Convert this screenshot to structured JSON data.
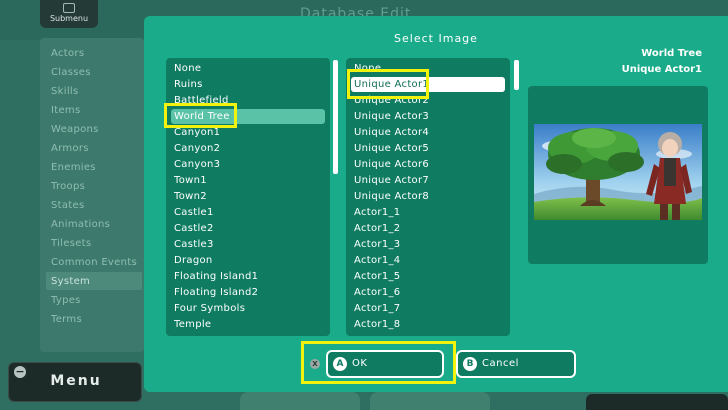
{
  "background": {
    "title": "Database Edit",
    "submenu_label": "Submenu",
    "sidebar_items": [
      "Actors",
      "Classes",
      "Skills",
      "Items",
      "Weapons",
      "Armors",
      "Enemies",
      "Troops",
      "States",
      "Animations",
      "Tilesets",
      "Common Events",
      "System",
      "Types",
      "Terms"
    ],
    "sidebar_selected": "System",
    "menu_label": "Menu"
  },
  "dialog": {
    "title": "Select Image",
    "folders": [
      "None",
      "Ruins",
      "Battlefield",
      "World Tree",
      "Canyon1",
      "Canyon2",
      "Canyon3",
      "Town1",
      "Town2",
      "Castle1",
      "Castle2",
      "Castle3",
      "Dragon",
      "Floating Island1",
      "Floating Island2",
      "Four Symbols",
      "Temple"
    ],
    "selected_folder": "World Tree",
    "images": [
      "None",
      "Unique Actor1",
      "Unique Actor2",
      "Unique Actor3",
      "Unique Actor4",
      "Unique Actor5",
      "Unique Actor6",
      "Unique Actor7",
      "Unique Actor8",
      "Actor1_1",
      "Actor1_2",
      "Actor1_3",
      "Actor1_4",
      "Actor1_5",
      "Actor1_6",
      "Actor1_7",
      "Actor1_8"
    ],
    "selected_image": "Unique Actor1",
    "preview_folder": "World Tree",
    "preview_image": "Unique Actor1",
    "ok_label": "OK",
    "cancel_label": "Cancel",
    "ok_glyph": "A",
    "cancel_glyph": "B",
    "x_glyph": "X"
  },
  "colors": {
    "dialog_bg": "#1aac8a",
    "panel_bg": "#0f7c62",
    "highlight": "#f2f20f"
  }
}
